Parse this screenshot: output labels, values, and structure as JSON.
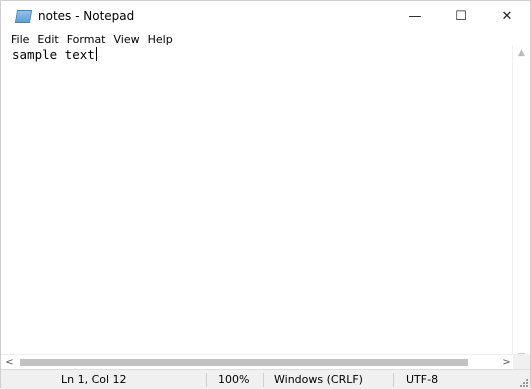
{
  "window": {
    "title": "notes - Notepad",
    "controls": {
      "minimize": "—",
      "maximize": "☐",
      "close": "✕"
    }
  },
  "menu": [
    "File",
    "Edit",
    "Format",
    "View",
    "Help"
  ],
  "editor": {
    "content": "sample text"
  },
  "scrollbars": {
    "vertical_up": "▲",
    "vertical_down": "▼",
    "horizontal_left": "<",
    "horizontal_right": ">"
  },
  "status": {
    "position": "Ln 1, Col 12",
    "zoom": "100%",
    "line_endings": "Windows (CRLF)",
    "encoding": "UTF-8"
  }
}
